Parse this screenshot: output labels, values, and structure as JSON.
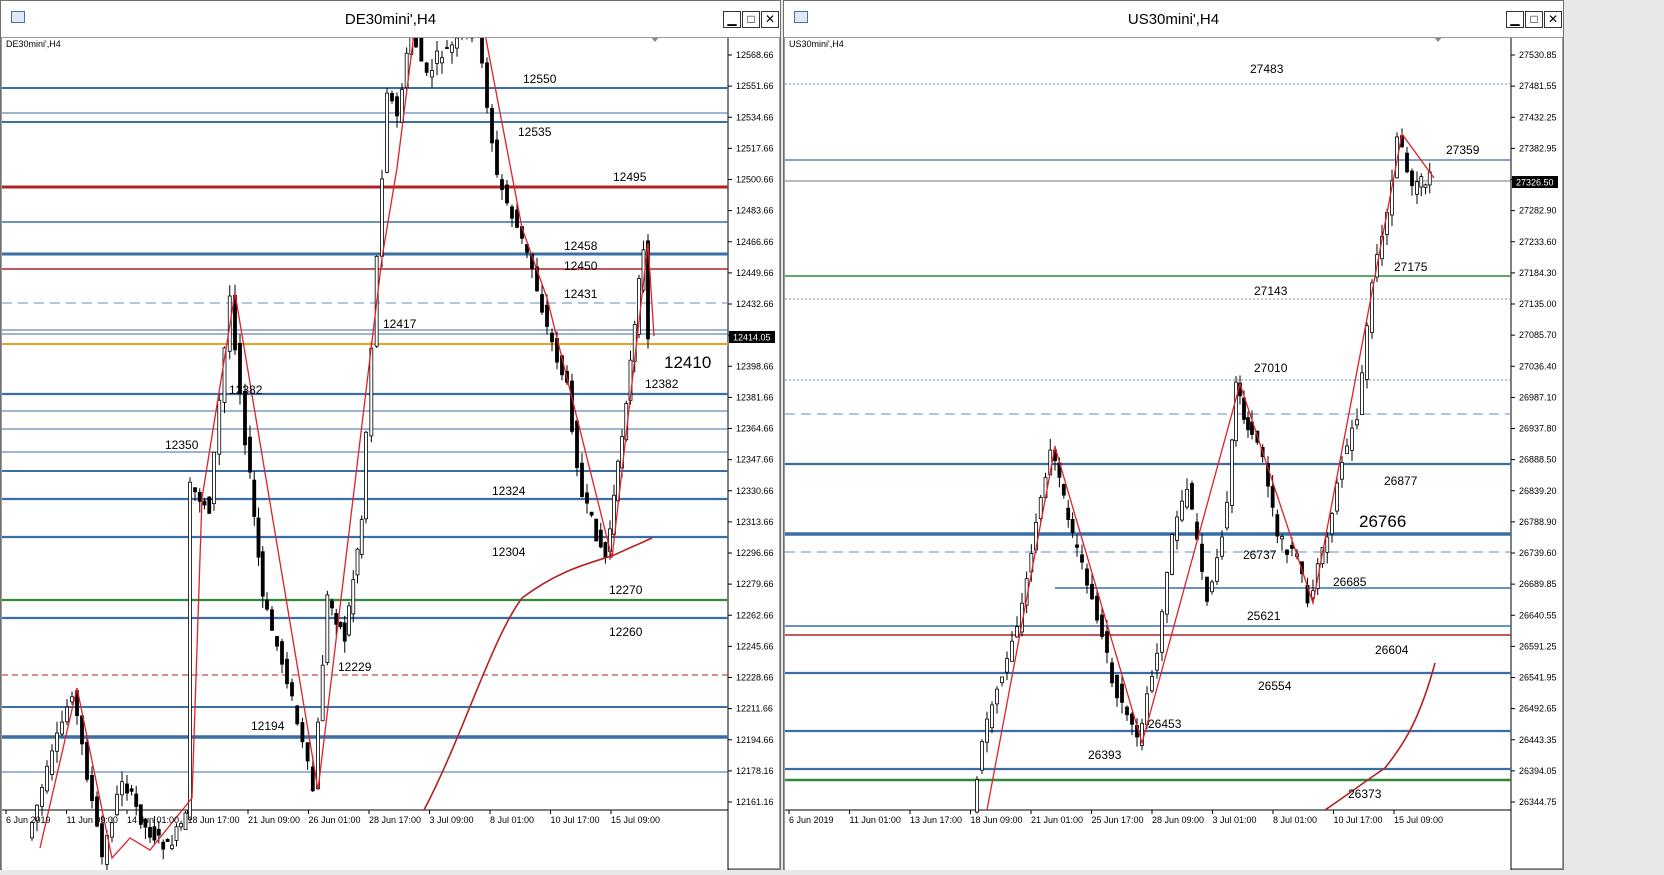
{
  "left": {
    "title": "DE30mini',H4",
    "symbol": "DE30mini',H4",
    "current_price": "12414.05",
    "axis_ticks": [
      "12568.66",
      "12551.66",
      "12534.66",
      "12517.66",
      "12500.66",
      "12483.66",
      "12466.66",
      "12449.66",
      "12432.66",
      "12415.66",
      "12398.66",
      "12381.66",
      "12364.66",
      "12347.66",
      "12330.66",
      "12313.66",
      "12296.66",
      "12279.66",
      "12262.66",
      "12245.66",
      "12228.66",
      "12211.66",
      "12194.66",
      "12178.16",
      "12161.16"
    ],
    "time_labels": [
      "6 Jun 2019",
      "11 Jun 09:00",
      "14 Jun 01:00",
      "18 Jun 17:00",
      "21 Jun 09:00",
      "26 Jun 01:00",
      "28 Jun 17:00",
      "3 Jul 09:00",
      "8 Jul 01:00",
      "10 Jul 17:00",
      "15 Jul 09:00"
    ],
    "levels": [
      "12550",
      "12535",
      "12495",
      "12458",
      "12450",
      "12431",
      "12417",
      "12410",
      "12382",
      "12382",
      "12350",
      "12324",
      "12304",
      "12270",
      "12260",
      "12229",
      "12194"
    ]
  },
  "right": {
    "title": "US30mini',H4",
    "symbol": "US30mini',H4",
    "current_price": "27326.50",
    "axis_ticks": [
      "27530.85",
      "27481.55",
      "27432.25",
      "27382.95",
      "27332.65",
      "27282.90",
      "27233.60",
      "27184.30",
      "27135.00",
      "27085.70",
      "27036.40",
      "26987.10",
      "26937.80",
      "26888.50",
      "26839.20",
      "26788.90",
      "26739.60",
      "26689.85",
      "26640.55",
      "26591.25",
      "26541.95",
      "26492.65",
      "26443.35",
      "26394.05",
      "26344.75"
    ],
    "time_labels": [
      "6 Jun 2019",
      "11 Jun 01:00",
      "13 Jun 17:00",
      "18 Jun 09:00",
      "21 Jun 01:00",
      "25 Jun 17:00",
      "28 Jun 09:00",
      "3 Jul 01:00",
      "8 Jul 01:00",
      "10 Jul 17:00",
      "15 Jul 09:00"
    ],
    "levels": [
      "27483",
      "27359",
      "27175",
      "27143",
      "27010",
      "26877",
      "26766",
      "26737",
      "26685",
      "25621",
      "26604",
      "26554",
      "26453",
      "26393",
      "26373"
    ]
  },
  "colors": {
    "blue_line": "#3a6ea5",
    "red_line": "#b22222",
    "green_line": "#2e8b3a",
    "orange_line": "#f0a020",
    "zigzag": "#e0202a",
    "candle": "#000000"
  }
}
